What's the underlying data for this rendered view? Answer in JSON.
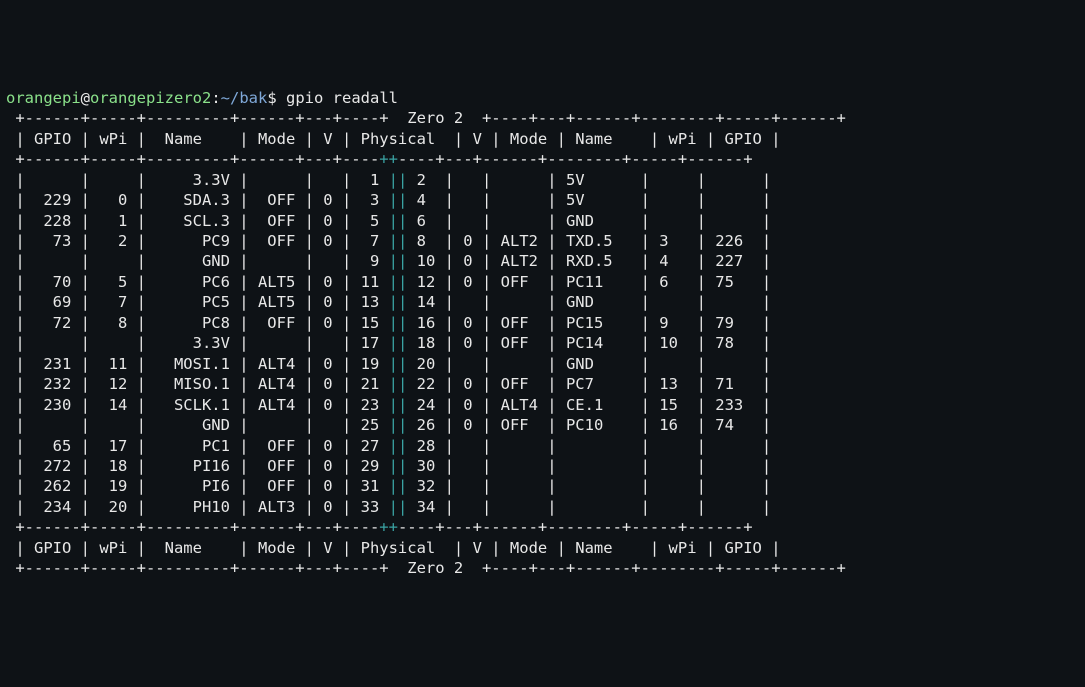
{
  "prompt": {
    "user": "orangepi",
    "host": "orangepizero2",
    "path": "~/bak",
    "sep1": "@",
    "sep2": ":",
    "dollar": "$",
    "command": "gpio readall"
  },
  "board": "Zero 2",
  "headers": [
    "GPIO",
    "wPi",
    "Name",
    "Mode",
    "V",
    "Physical",
    "V",
    "Mode",
    "Name",
    "wPi",
    "GPIO"
  ],
  "rows": [
    {
      "l_gpio": "",
      "l_wpi": "",
      "l_name": "3.3V",
      "l_mode": "",
      "l_v": "",
      "phys_l": "1",
      "phys_r": "2",
      "r_v": "",
      "r_mode": "",
      "r_name": "5V",
      "r_wpi": "",
      "r_gpio": ""
    },
    {
      "l_gpio": "229",
      "l_wpi": "0",
      "l_name": "SDA.3",
      "l_mode": "OFF",
      "l_v": "0",
      "phys_l": "3",
      "phys_r": "4",
      "r_v": "",
      "r_mode": "",
      "r_name": "5V",
      "r_wpi": "",
      "r_gpio": ""
    },
    {
      "l_gpio": "228",
      "l_wpi": "1",
      "l_name": "SCL.3",
      "l_mode": "OFF",
      "l_v": "0",
      "phys_l": "5",
      "phys_r": "6",
      "r_v": "",
      "r_mode": "",
      "r_name": "GND",
      "r_wpi": "",
      "r_gpio": ""
    },
    {
      "l_gpio": "73",
      "l_wpi": "2",
      "l_name": "PC9",
      "l_mode": "OFF",
      "l_v": "0",
      "phys_l": "7",
      "phys_r": "8",
      "r_v": "0",
      "r_mode": "ALT2",
      "r_name": "TXD.5",
      "r_wpi": "3",
      "r_gpio": "226"
    },
    {
      "l_gpio": "",
      "l_wpi": "",
      "l_name": "GND",
      "l_mode": "",
      "l_v": "",
      "phys_l": "9",
      "phys_r": "10",
      "r_v": "0",
      "r_mode": "ALT2",
      "r_name": "RXD.5",
      "r_wpi": "4",
      "r_gpio": "227"
    },
    {
      "l_gpio": "70",
      "l_wpi": "5",
      "l_name": "PC6",
      "l_mode": "ALT5",
      "l_v": "0",
      "phys_l": "11",
      "phys_r": "12",
      "r_v": "0",
      "r_mode": "OFF",
      "r_name": "PC11",
      "r_wpi": "6",
      "r_gpio": "75"
    },
    {
      "l_gpio": "69",
      "l_wpi": "7",
      "l_name": "PC5",
      "l_mode": "ALT5",
      "l_v": "0",
      "phys_l": "13",
      "phys_r": "14",
      "r_v": "",
      "r_mode": "",
      "r_name": "GND",
      "r_wpi": "",
      "r_gpio": ""
    },
    {
      "l_gpio": "72",
      "l_wpi": "8",
      "l_name": "PC8",
      "l_mode": "OFF",
      "l_v": "0",
      "phys_l": "15",
      "phys_r": "16",
      "r_v": "0",
      "r_mode": "OFF",
      "r_name": "PC15",
      "r_wpi": "9",
      "r_gpio": "79"
    },
    {
      "l_gpio": "",
      "l_wpi": "",
      "l_name": "3.3V",
      "l_mode": "",
      "l_v": "",
      "phys_l": "17",
      "phys_r": "18",
      "r_v": "0",
      "r_mode": "OFF",
      "r_name": "PC14",
      "r_wpi": "10",
      "r_gpio": "78"
    },
    {
      "l_gpio": "231",
      "l_wpi": "11",
      "l_name": "MOSI.1",
      "l_mode": "ALT4",
      "l_v": "0",
      "phys_l": "19",
      "phys_r": "20",
      "r_v": "",
      "r_mode": "",
      "r_name": "GND",
      "r_wpi": "",
      "r_gpio": ""
    },
    {
      "l_gpio": "232",
      "l_wpi": "12",
      "l_name": "MISO.1",
      "l_mode": "ALT4",
      "l_v": "0",
      "phys_l": "21",
      "phys_r": "22",
      "r_v": "0",
      "r_mode": "OFF",
      "r_name": "PC7",
      "r_wpi": "13",
      "r_gpio": "71"
    },
    {
      "l_gpio": "230",
      "l_wpi": "14",
      "l_name": "SCLK.1",
      "l_mode": "ALT4",
      "l_v": "0",
      "phys_l": "23",
      "phys_r": "24",
      "r_v": "0",
      "r_mode": "ALT4",
      "r_name": "CE.1",
      "r_wpi": "15",
      "r_gpio": "233"
    },
    {
      "l_gpio": "",
      "l_wpi": "",
      "l_name": "GND",
      "l_mode": "",
      "l_v": "",
      "phys_l": "25",
      "phys_r": "26",
      "r_v": "0",
      "r_mode": "OFF",
      "r_name": "PC10",
      "r_wpi": "16",
      "r_gpio": "74"
    },
    {
      "l_gpio": "65",
      "l_wpi": "17",
      "l_name": "PC1",
      "l_mode": "OFF",
      "l_v": "0",
      "phys_l": "27",
      "phys_r": "28",
      "r_v": "",
      "r_mode": "",
      "r_name": "",
      "r_wpi": "",
      "r_gpio": ""
    },
    {
      "l_gpio": "272",
      "l_wpi": "18",
      "l_name": "PI16",
      "l_mode": "OFF",
      "l_v": "0",
      "phys_l": "29",
      "phys_r": "30",
      "r_v": "",
      "r_mode": "",
      "r_name": "",
      "r_wpi": "",
      "r_gpio": ""
    },
    {
      "l_gpio": "262",
      "l_wpi": "19",
      "l_name": "PI6",
      "l_mode": "OFF",
      "l_v": "0",
      "phys_l": "31",
      "phys_r": "32",
      "r_v": "",
      "r_mode": "",
      "r_name": "",
      "r_wpi": "",
      "r_gpio": ""
    },
    {
      "l_gpio": "234",
      "l_wpi": "20",
      "l_name": "PH10",
      "l_mode": "ALT3",
      "l_v": "0",
      "phys_l": "33",
      "phys_r": "34",
      "r_v": "",
      "r_mode": "",
      "r_name": "",
      "r_wpi": "",
      "r_gpio": ""
    }
  ]
}
